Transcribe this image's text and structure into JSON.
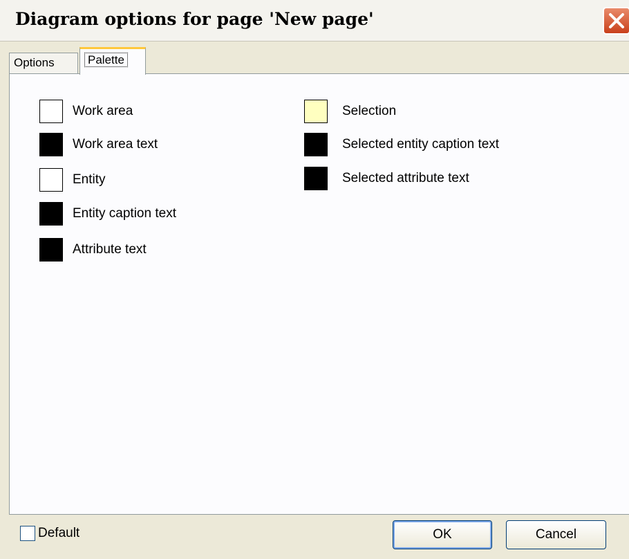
{
  "window": {
    "title": "Diagram options for page 'New page'"
  },
  "tabs": [
    {
      "label": "Options",
      "active": false
    },
    {
      "label": "Palette",
      "active": true
    }
  ],
  "palette": {
    "left": [
      {
        "label": "Work area",
        "color": "#ffffff"
      },
      {
        "label": "Work area text",
        "color": "#000000"
      },
      {
        "label": "Entity",
        "color": "#ffffff"
      },
      {
        "label": "Entity caption text",
        "color": "#000000"
      },
      {
        "label": "Attribute text",
        "color": "#000000"
      }
    ],
    "right": [
      {
        "label": "Selection",
        "color": "#ffffc0"
      },
      {
        "label": "Selected entity caption text",
        "color": "#000000"
      },
      {
        "label": "Selected attribute text",
        "color": "#000000"
      }
    ]
  },
  "footer": {
    "default_label": "Default",
    "default_checked": false,
    "ok_label": "OK",
    "cancel_label": "Cancel"
  },
  "icons": {
    "close": "close-icon"
  }
}
